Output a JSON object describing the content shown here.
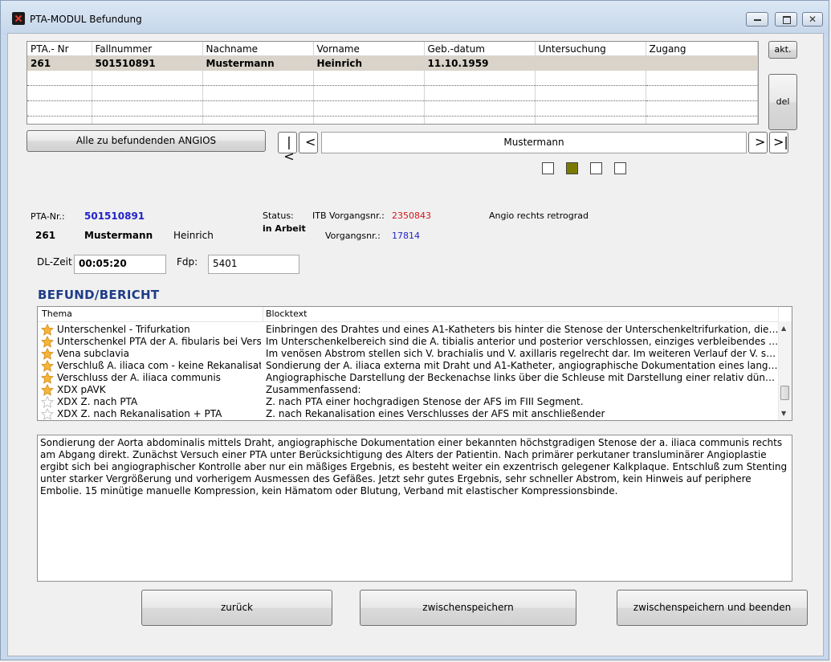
{
  "window": {
    "title": "PTA-MODUL Befundung"
  },
  "grid": {
    "columns": [
      "PTA.- Nr",
      "Fallnummer",
      "Nachname",
      "Vorname",
      "Geb.-datum",
      "Untersuchung",
      "Zugang"
    ],
    "selected_row": [
      "261",
      "501510891",
      "Mustermann",
      "Heinrich",
      "11.10.1959",
      "",
      ""
    ]
  },
  "buttons": {
    "akt": "akt.",
    "del": "del",
    "alle": "Alle zu befundenden ANGIOS",
    "back": "zurück",
    "save": "zwischenspeichern",
    "save_exit": "zwischenspeichern und beenden"
  },
  "nav": {
    "current": "Mustermann"
  },
  "color_squares": [
    "#ffffff",
    "#7a7a00",
    "#ffffff",
    "#ffffff"
  ],
  "patient": {
    "pta_nr_label": "PTA-Nr.:",
    "pta_nr_value": "501510891",
    "nr": "261",
    "nachname": "Mustermann",
    "vorname": "Heinrich",
    "status_label": "Status:",
    "status_value": "in Arbeit",
    "itb_label": "ITB Vorgangsnr.:",
    "itb_value": "2350843",
    "vorgang_label": "Vorgangsnr.:",
    "vorgang_value": "17814",
    "angio": "Angio rechts retrograd",
    "dl_label": "DL-Zeit",
    "dl_value": "00:05:20",
    "fdp_label": "Fdp:",
    "fdp_value": "5401"
  },
  "befund": {
    "title": "BEFUND/BERICHT",
    "col_thema": "Thema",
    "col_block": "Blocktext",
    "rows": [
      {
        "star": "gold",
        "thema": "Unterschenkel - Trifurkation",
        "block": "Einbringen des Drahtes und eines A1-Katheters bis hinter die Stenose der Unterschenkeltrifurkation, die  eine Länge von ..."
      },
      {
        "star": "gold",
        "thema": "Unterschenkel PTA der A. fibularis bei Verschluß",
        "block": "Im Unterschenkelbereich sind die A. tibialis anterior und posterior verschlossen, einziges verbleibendes Gefäß ist die A. fi..."
      },
      {
        "star": "gold",
        "thema": "Vena subclavia",
        "block": "Im venösen Abstrom stellen sich V. brachialis und V. axillaris regelrecht dar. Im weiteren Verlauf der V. subclavia zeigt sic..."
      },
      {
        "star": "gold",
        "thema": "Verschluß A. iliaca com - keine Rekanalisation",
        "block": "Sondierung der A. iliaca externa mit Draht und A1-Katheter, angiographische Dokumentation eines langstreckigen Versc..."
      },
      {
        "star": "gold",
        "thema": "Verschluss der A. iliaca communis",
        "block": "Angiographische Darstellung der Beckenachse links über die Schleuse mit Darstellung einer relativ dünnkalibrigen, arteri..."
      },
      {
        "star": "gold",
        "thema": "XDX  pAVK",
        "block": "Zusammenfassend:"
      },
      {
        "star": "white",
        "thema": "XDX  Z. nach PTA",
        "block": "Z. nach PTA einer hochgradigen Stenose der AFS im FIII Segment."
      },
      {
        "star": "white",
        "thema": "XDX  Z. nach Rekanalisation + PTA",
        "block": "Z. nach Rekanalisation eines Verschlusses der AFS mit anschließender"
      }
    ],
    "text": "Sondierung der Aorta abdominalis mittels Draht, angiographische Dokumentation einer bekannten höchstgradigen Stenose der a. iliaca communis rechts am Abgang direkt. Zunächst Versuch einer PTA unter Berücksichtigung des Alters der Patientin. Nach primärer perkutaner transluminärer Angioplastie ergibt sich bei angiographischer Kontrolle aber nur ein mäßiges Ergebnis, es besteht weiter ein exzentrisch gelegener Kalkplaque. Entschluß zum Stenting unter starker Vergrößerung und vorherigem Ausmessen des Gefäßes. Jetzt sehr gutes Ergebnis, sehr schneller Abstrom, kein Hinweis auf periphere Embolie. 15 minütige manuelle Kompression, kein Hämatom oder Blutung, Verband mit elastischer Kompressionsbinde."
  }
}
